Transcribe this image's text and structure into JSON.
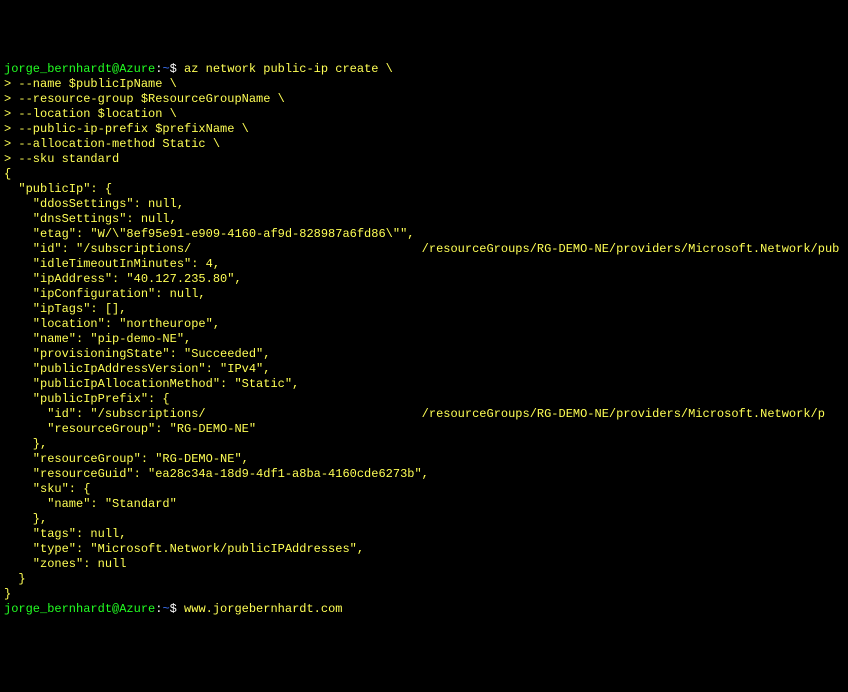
{
  "prompt1": {
    "user_host": "jorge_bernhardt@Azure",
    "colon_tilde": ":~$",
    "dollar": "$ ",
    "command": "az network public-ip create \\"
  },
  "cont": [
    "> --name $publicIpName \\",
    "> --resource-group $ResourceGroupName \\",
    "> --location $location \\",
    "> --public-ip-prefix $prefixName \\",
    "> --allocation-method Static \\",
    "> --sku standard"
  ],
  "prompt2": {
    "user_host": "jorge_bernhardt@Azure",
    "command": "www.jorgebernhardt.com"
  },
  "out": {
    "l0": "{",
    "l1": "  \"publicIp\": {",
    "l2": "    \"ddosSettings\": null,",
    "l3": "    \"dnsSettings\": null,",
    "l4": "    \"etag\": \"W/\\\"8ef95e91-e909-4160-af9d-828987a6fd86\\\"\",",
    "l5a": "    \"id\": \"/subscriptions/",
    "l5b": "                                /resourceGroups/RG-DEMO-NE/providers/Microsoft.Network/pub",
    "l6": "    \"idleTimeoutInMinutes\": 4,",
    "l7": "    \"ipAddress\": \"40.127.235.80\",",
    "l8": "    \"ipConfiguration\": null,",
    "l9": "    \"ipTags\": [],",
    "l10": "    \"location\": \"northeurope\",",
    "l11": "    \"name\": \"pip-demo-NE\",",
    "l12": "    \"provisioningState\": \"Succeeded\",",
    "l13": "    \"publicIpAddressVersion\": \"IPv4\",",
    "l14": "    \"publicIpAllocationMethod\": \"Static\",",
    "l15": "    \"publicIpPrefix\": {",
    "l16a": "      \"id\": \"/subscriptions/",
    "l16b": "                              /resourceGroups/RG-DEMO-NE/providers/Microsoft.Network/p",
    "l17": "      \"resourceGroup\": \"RG-DEMO-NE\"",
    "l18": "    },",
    "l19": "    \"resourceGroup\": \"RG-DEMO-NE\",",
    "l20": "    \"resourceGuid\": \"ea28c34a-18d9-4df1-a8ba-4160cde6273b\",",
    "l21": "    \"sku\": {",
    "l22": "      \"name\": \"Standard\"",
    "l23": "    },",
    "l24": "    \"tags\": null,",
    "l25": "    \"type\": \"Microsoft.Network/publicIPAddresses\",",
    "l26": "    \"zones\": null",
    "l27": "  }",
    "l28": "}"
  }
}
